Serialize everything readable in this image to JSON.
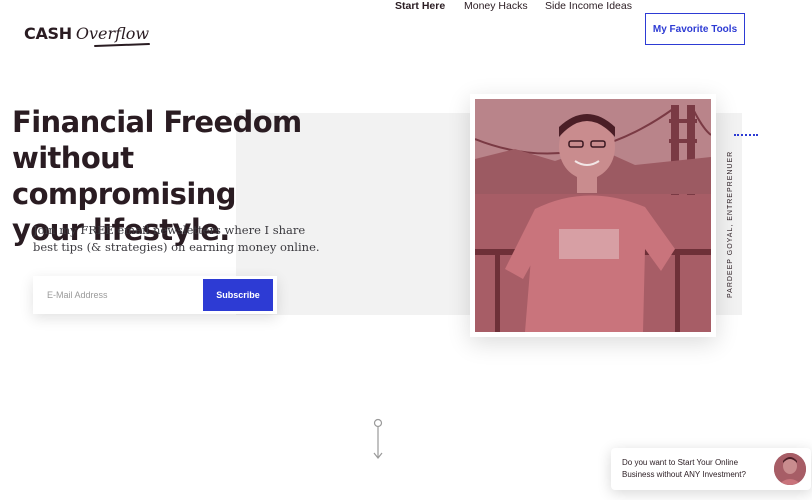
{
  "header": {
    "logo_cash": "CASH",
    "logo_overflow": "Overflow",
    "nav": {
      "start_here": "Start Here",
      "money_hacks": "Money Hacks",
      "side_income": "Side Income Ideas",
      "favorite_tools": "My Favorite Tools"
    }
  },
  "hero": {
    "headline_lines": [
      "Financial Freedom",
      "without compromising",
      "your lifestyle."
    ],
    "intro": "Join my FREE email newsletters where I share best tips (& strategies) on earning money online.",
    "email_placeholder": "E-Mail Address",
    "subscribe_label": "Subscribe",
    "side_caption": "PARDEEP GOYAL, ENTREPRENUER"
  },
  "chat": {
    "message": "Do you want to Start Your Online Business without ANY Investment?"
  },
  "colors": {
    "accent": "#2d3bd4",
    "text_dark": "#2a1c22",
    "panel_gray": "#f2f2f2",
    "photo_tint": "#a2535d"
  }
}
